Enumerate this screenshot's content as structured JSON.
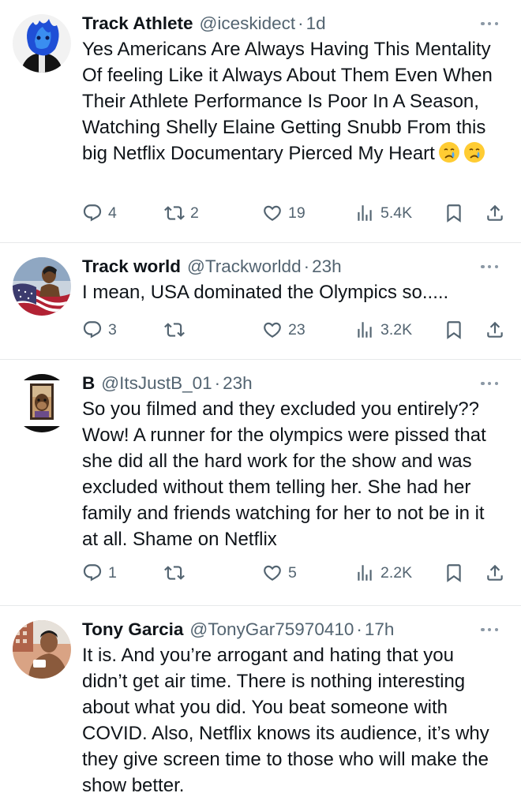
{
  "tweets": [
    {
      "name": "Track Athlete",
      "handle": "@iceskidect",
      "dot": "·",
      "time": "1d",
      "avatar_icon": "blue-flame-face-avatar",
      "text": "Yes Americans Are Always Having This Mentality Of feeling Like it Always About Them Even When Their Athlete Performance Is Poor In A Season, Watching Shelly Elaine Getting Snubb From this big Netflix Documentary Pierced My Heart",
      "emojis": [
        "crying-face-emoji",
        "crying-face-emoji"
      ],
      "replies": "4",
      "retweets": "2",
      "likes": "19",
      "views": "5.4K"
    },
    {
      "name": "Track world",
      "handle": "@Trackworldd",
      "dot": "·",
      "time": "23h",
      "avatar_icon": "athlete-with-flag-avatar",
      "text": "I mean, USA dominated the Olympics so.....",
      "replies": "3",
      "retweets": "",
      "likes": "23",
      "views": "3.2K"
    },
    {
      "name": "B",
      "handle": "@ItsJustB_01",
      "dot": "·",
      "time": "23h",
      "avatar_icon": "framed-ape-avatar",
      "text": "So you filmed and they excluded you entirely?? Wow! A runner for the olympics were pissed that she did all the hard work for the show and was excluded without them telling her. She had her family and friends watching for her to not be in it at all. Shame on Netflix",
      "replies": "1",
      "retweets": "",
      "likes": "5",
      "views": "2.2K"
    },
    {
      "name": "Tony Garcia",
      "handle": "@TonyGar75970410",
      "dot": "·",
      "time": "17h",
      "avatar_icon": "man-selfie-avatar",
      "text": "It is. And you’re arrogant and hating that you didn’t get air time. There is nothing interesting about what you did. You beat someone with COVID. Also, Netflix knows its audience, it’s why they give screen time to those who will make the show better."
    }
  ],
  "colors": {
    "text": "#0f1419",
    "secondary": "#536471",
    "divider": "#e7e9ea",
    "background": "#ffffff"
  },
  "icons": {
    "reply": "reply-icon",
    "retweet": "retweet-icon",
    "like": "heart-icon",
    "views": "views-bar-chart-icon",
    "bookmark": "bookmark-icon",
    "share": "share-icon",
    "more": "more-options-icon"
  }
}
